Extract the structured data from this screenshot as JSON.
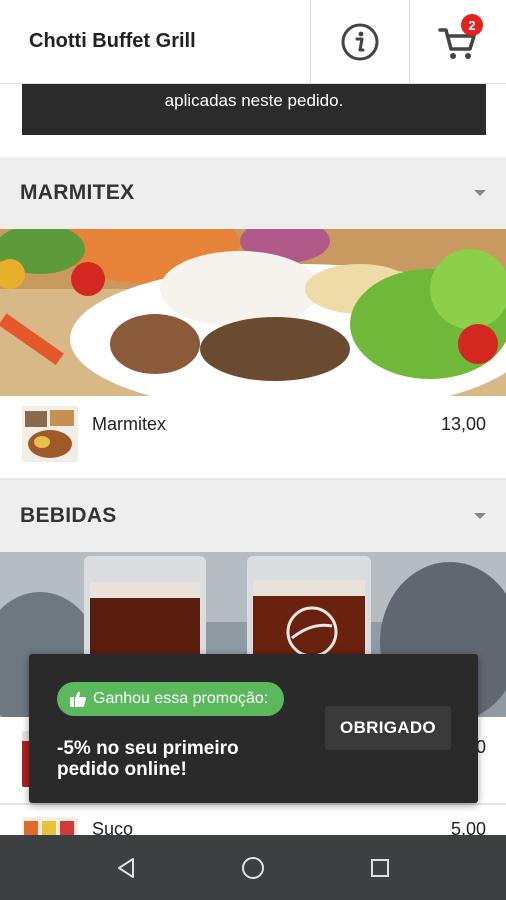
{
  "header": {
    "title": "Chotti Buffet Grill",
    "info_icon": "info-circle-icon",
    "cart_icon": "shopping-cart-icon",
    "cart_count": "2"
  },
  "notice": {
    "text": "aplicadas neste pedido."
  },
  "sections": [
    {
      "title": "MARMITEX",
      "items": [
        {
          "name": "Marmitex",
          "price": "13,00"
        }
      ]
    },
    {
      "title": "BEBIDAS",
      "items": [
        {
          "name": "",
          "price": "0"
        },
        {
          "name": "Suco",
          "price": "5,00"
        }
      ]
    }
  ],
  "snackbar": {
    "badge_icon": "thumbs-up-icon",
    "badge_label": "Ganhou essa promoção:",
    "message": "-5% no seu primeiro pedido online!",
    "button_label": "OBRIGADO"
  },
  "colors": {
    "badge_red": "#e52222",
    "promo_green": "#5cb85c",
    "snackbar_bg": "#2a2a2a",
    "navbar_bg": "#3c4043"
  },
  "navbar": {
    "back_icon": "back-triangle-icon",
    "home_icon": "home-circle-icon",
    "recents_icon": "recents-square-icon"
  }
}
